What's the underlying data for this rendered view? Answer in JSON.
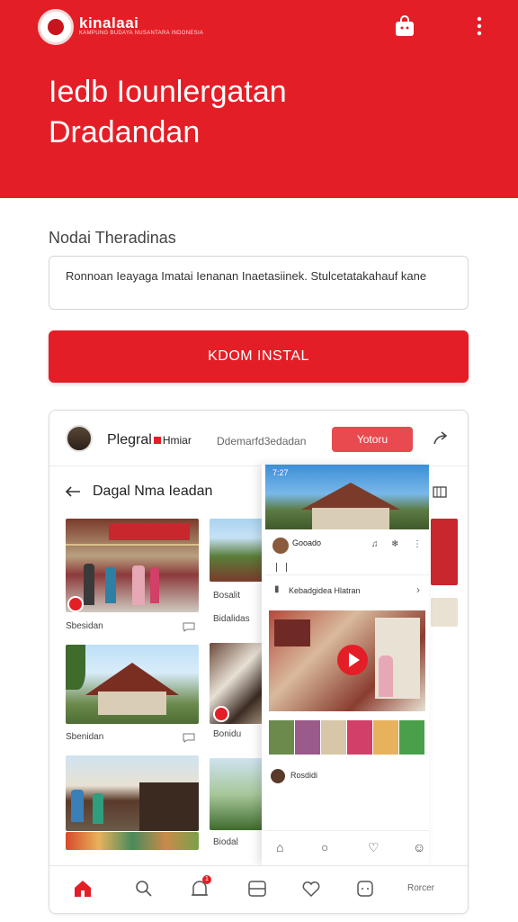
{
  "header": {
    "brand_name": "kinalaai",
    "brand_tagline": "KAMPUNG BUDAYA NUSANTARA INDONESIA",
    "title_line1": "Iedb Iounlergatan",
    "title_line2": "Dradandan",
    "bag_icon": "shopping-bag-icon",
    "menu_icon": "more-vertical-icon",
    "accent_color": "#e41e26"
  },
  "form": {
    "section_label": "Nodai Theradinas",
    "input_text": "Ronnoan Ieayaga Imatai Ienanan Inaetasiinek. Stulcetatakahauf kane",
    "install_label": "KDOM INSTAL"
  },
  "preview": {
    "profile_name": "Plegral",
    "profile_name_suffix": "Hmiar",
    "profile_sub": "Ddemarfd3edadan",
    "action_label": "Yotoru",
    "share_icon": "share-arrow-icon",
    "page_title": "Dagal Nma Ieadan",
    "back_icon": "back-arrow-icon",
    "grid_icon": "grid-view-icon",
    "cards": [
      {
        "label": "Sbesidan"
      },
      {
        "label": "Sbenidan"
      },
      {
        "label": ""
      }
    ],
    "col2_labels": [
      "Bosalit",
      "Bidalidas",
      "Bonidu",
      "Biodal"
    ],
    "phone": {
      "status": "7:27",
      "name": "Gooado",
      "row_label": "Kebadgidea Hlatran",
      "foot_label": "Rosdidi"
    },
    "bottom_nav": {
      "last_label": "Rorcer",
      "badge": "1"
    }
  }
}
